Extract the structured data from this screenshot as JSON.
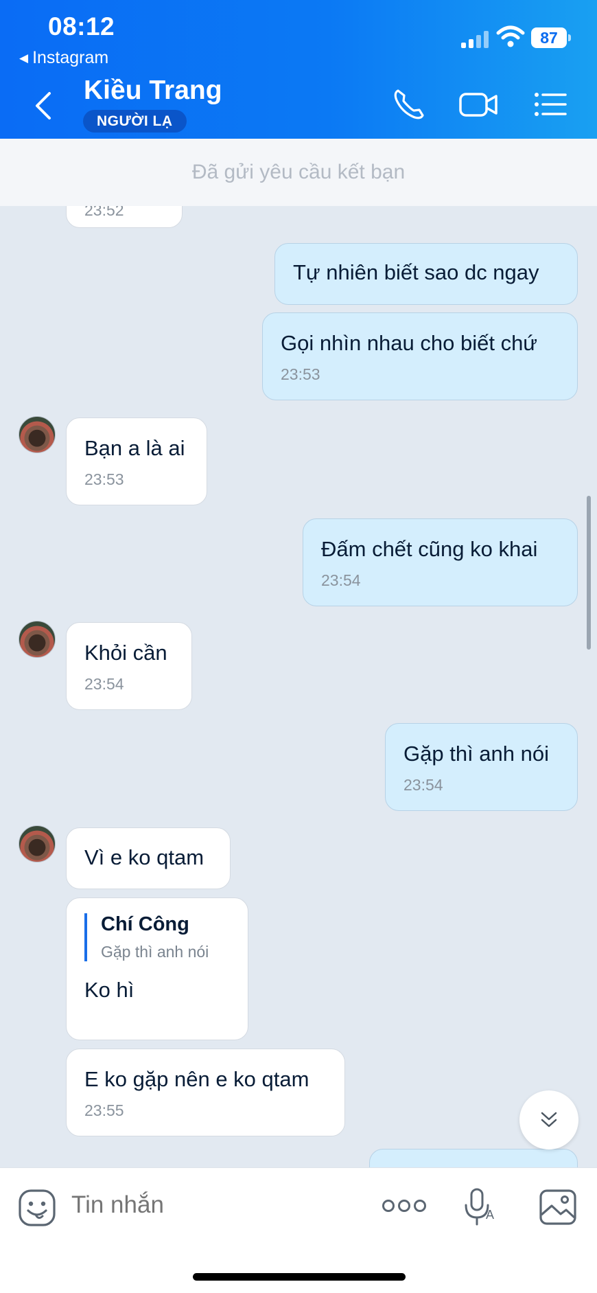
{
  "status_bar": {
    "time": "08:12",
    "back_app": "Instagram",
    "battery": "87"
  },
  "header": {
    "contact_name": "Kiều Trang",
    "badge": "NGƯỜI LẠ",
    "icons": [
      "back-chevron-icon",
      "phone-icon",
      "video-icon",
      "list-icon"
    ]
  },
  "request_bar": {
    "text": "Đã gửi yêu cầu kết bạn"
  },
  "messages": [
    {
      "side": "in",
      "text": "",
      "time": "23:52"
    },
    {
      "side": "out",
      "text": "Tự nhiên biết sao dc ngay",
      "time": ""
    },
    {
      "side": "out",
      "text": "Gọi nhìn nhau cho biết chứ",
      "time": "23:53"
    },
    {
      "side": "in",
      "text": "Bạn a là ai",
      "time": "23:53"
    },
    {
      "side": "out",
      "text": "Đấm chết cũng ko khai",
      "time": "23:54"
    },
    {
      "side": "in",
      "text": "Khỏi cần",
      "time": "23:54"
    },
    {
      "side": "out",
      "text": "Gặp thì anh nói",
      "time": "23:54"
    },
    {
      "side": "in",
      "text": "Vì e ko qtam",
      "time": ""
    },
    {
      "side": "in",
      "text": "Ko hì",
      "time": "",
      "quote": {
        "name": "Chí Công",
        "text": "Gặp thì anh nói"
      }
    },
    {
      "side": "in",
      "text": "E ko gặp nên e ko qtam",
      "time": "23:55"
    }
  ],
  "composer": {
    "placeholder": "Tin nhắn"
  },
  "colors": {
    "header_start": "#0a6cf5",
    "header_end": "#19a0f2",
    "out_bubble": "#d4eefd",
    "in_bubble": "#ffffff",
    "chat_bg": "#e2e9f1"
  }
}
